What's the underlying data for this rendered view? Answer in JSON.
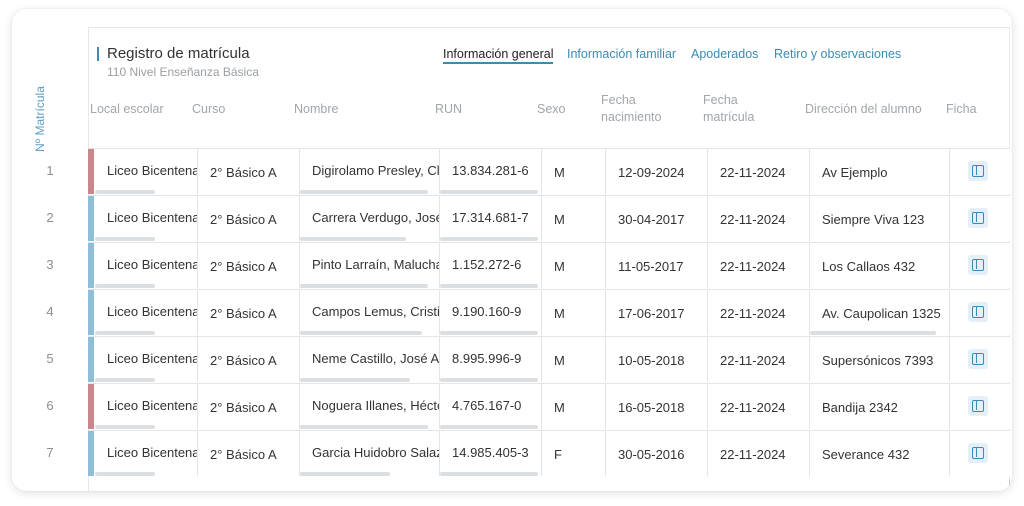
{
  "header": {
    "title": "Registro de matrícula",
    "subtitle": "110 Nivel Enseñanza Básica"
  },
  "tabs": [
    {
      "label": "Información general",
      "active": true
    },
    {
      "label": "Información familiar",
      "active": false
    },
    {
      "label": "Apoderados",
      "active": false
    },
    {
      "label": "Retiro y observaciones",
      "active": false
    }
  ],
  "side_label": "Nº Matrícula",
  "columns": {
    "local": "Local escolar",
    "curso": "Curso",
    "nombre": "Nombre",
    "run": "RUN",
    "sexo": "Sexo",
    "fecha_nac_1": "Fecha",
    "fecha_nac_2": "nacimiento",
    "fecha_mat_1": "Fecha",
    "fecha_mat_2": "matrícula",
    "direccion": "Dirección del alumno",
    "ficha": "Ficha"
  },
  "colors": {
    "accent": "#3c8ab5",
    "row_female": "#c9878b",
    "row_male": "#8fbfd6"
  },
  "rows": [
    {
      "num": "1",
      "accent": "pink",
      "local": "Liceo Bicentenario",
      "curso": "2° Básico A",
      "nombre": "Digirolamo Presley, Clara",
      "run": "13.834.281-6",
      "sexo": "M",
      "nacimiento": "12-09-2024",
      "matricula": "22-11-2024",
      "direccion": "Av Ejemplo",
      "ficha_icon": "sidebar-panel-icon"
    },
    {
      "num": "2",
      "accent": "blue",
      "local": "Liceo Bicentenario",
      "curso": "2° Básico A",
      "nombre": "Carrera Verdugo, José Miguel",
      "run": "17.314.681-7",
      "sexo": "M",
      "nacimiento": "30-04-2017",
      "matricula": "22-11-2024",
      "direccion": "Siempre Viva 123",
      "ficha_icon": "sidebar-panel-icon"
    },
    {
      "num": "3",
      "accent": "blue",
      "local": "Liceo Bicentenario",
      "curso": "2° Básico A",
      "nombre": "Pinto Larraín, Malucha",
      "run": "1.152.272-6",
      "sexo": "M",
      "nacimiento": "11-05-2017",
      "matricula": "22-11-2024",
      "direccion": "Los Callaos 432",
      "ficha_icon": "sidebar-panel-icon"
    },
    {
      "num": "4",
      "accent": "blue",
      "local": "Liceo Bicentenario",
      "curso": "2° Básico A",
      "nombre": "Campos Lemus, Cristian",
      "run": "9.190.160-9",
      "sexo": "M",
      "nacimiento": "17-06-2017",
      "matricula": "22-11-2024",
      "direccion": "Av. Caupolican 1325",
      "ficha_icon": "sidebar-panel-icon"
    },
    {
      "num": "5",
      "accent": "blue",
      "local": "Liceo Bicentenario",
      "curso": "2° Básico A",
      "nombre": "Neme Castillo, José Antonio",
      "run": "8.995.996-9",
      "sexo": "M",
      "nacimiento": "10-05-2018",
      "matricula": "22-11-2024",
      "direccion": "Supersónicos 7393",
      "ficha_icon": "sidebar-panel-icon"
    },
    {
      "num": "6",
      "accent": "pink",
      "local": "Liceo Bicentenario",
      "curso": "2° Básico A",
      "nombre": "Noguera Illanes, Héctor",
      "run": "4.765.167-0",
      "sexo": "M",
      "nacimiento": "16-05-2018",
      "matricula": "22-11-2024",
      "direccion": "Bandija 2342",
      "ficha_icon": "sidebar-panel-icon"
    },
    {
      "num": "7",
      "accent": "blue",
      "local": "Liceo Bicentenario",
      "curso": "2° Básico A",
      "nombre": "Garcia Huidobro Salazar",
      "run": "14.985.405-3",
      "sexo": "F",
      "nacimiento": "30-05-2016",
      "matricula": "22-11-2024",
      "direccion": "Severance 432",
      "ficha_icon": "sidebar-panel-icon"
    }
  ]
}
